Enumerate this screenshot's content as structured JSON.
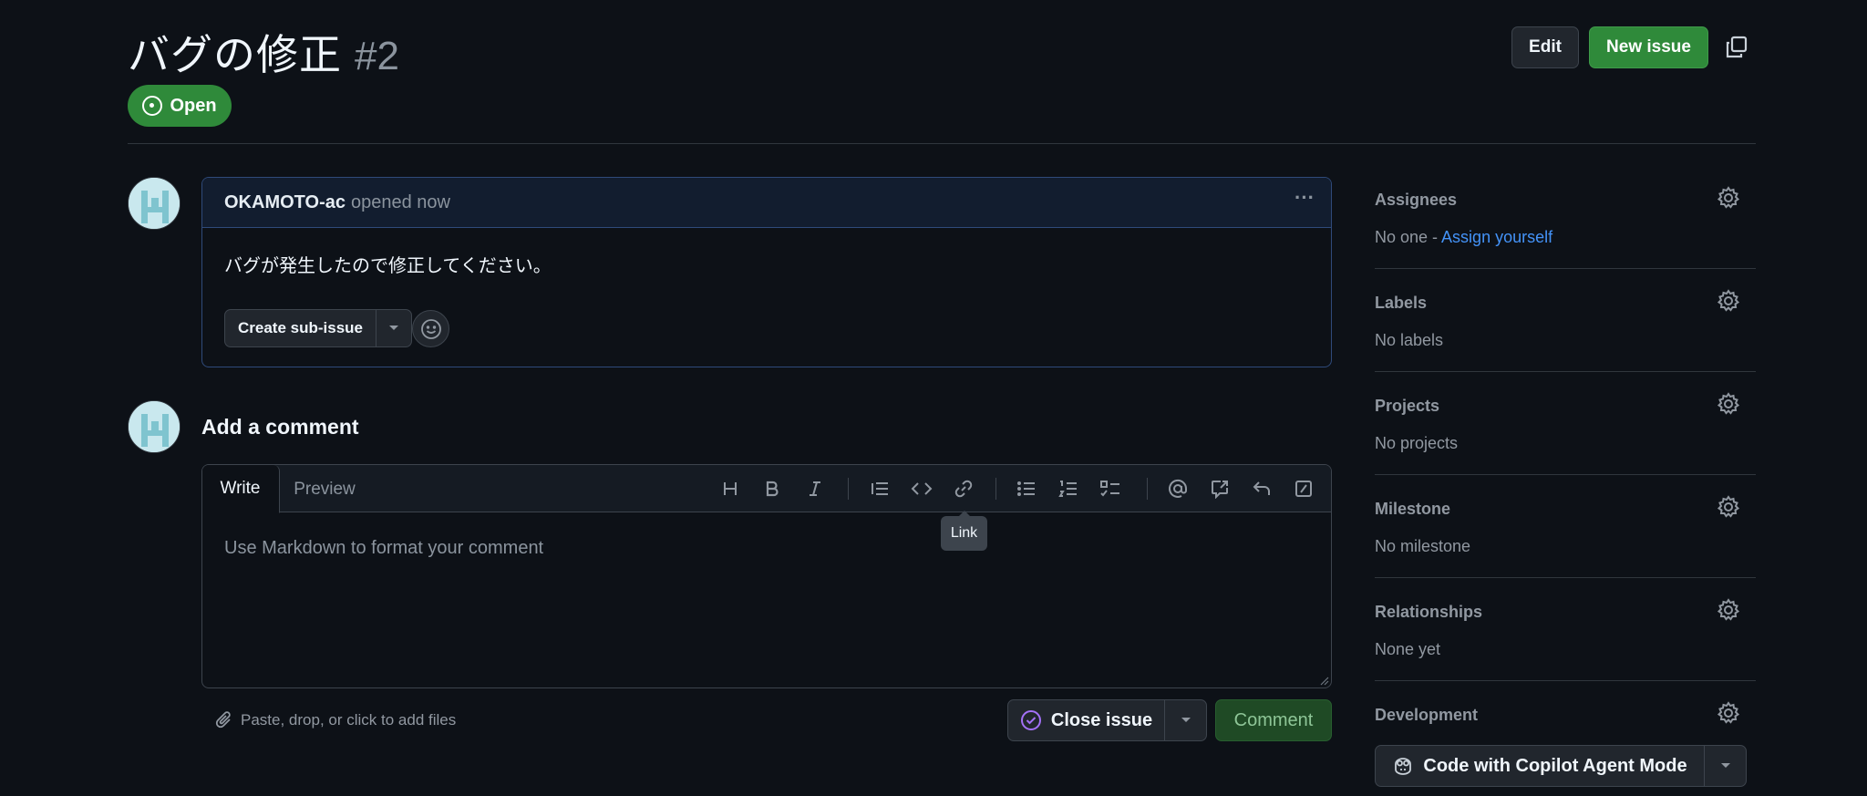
{
  "issue": {
    "title": "バグの修正",
    "number": "#2",
    "state": "Open"
  },
  "header": {
    "edit_label": "Edit",
    "new_issue_label": "New issue"
  },
  "comment": {
    "author": "OKAMOTO-ac",
    "time_text": "opened now",
    "body": "バグが発生したので修正してください。",
    "sub_issue_label": "Create sub-issue"
  },
  "composer": {
    "heading": "Add a comment",
    "tabs": {
      "write": "Write",
      "preview": "Preview"
    },
    "toolbar": [
      "heading-icon",
      "bold-icon",
      "italic-icon",
      "quote-icon",
      "code-icon",
      "link-icon",
      "unordered-list-icon",
      "ordered-list-icon",
      "task-list-icon",
      "mention-icon",
      "cross-reference-icon",
      "reply-icon",
      "slash-command-icon"
    ],
    "placeholder": "Use Markdown to format your comment",
    "tooltip": "Link",
    "attach_text": "Paste, drop, or click to add files",
    "close_issue_label": "Close issue",
    "comment_label": "Comment"
  },
  "sidebar": {
    "assignees": {
      "title": "Assignees",
      "value": "No one - ",
      "link": "Assign yourself"
    },
    "labels": {
      "title": "Labels",
      "value": "No labels"
    },
    "projects": {
      "title": "Projects",
      "value": "No projects"
    },
    "milestone": {
      "title": "Milestone",
      "value": "No milestone"
    },
    "relationships": {
      "title": "Relationships",
      "value": "None yet"
    },
    "development": {
      "title": "Development",
      "copilot_label": "Code with Copilot Agent Mode"
    }
  },
  "colors": {
    "background": "#0d1117",
    "open_green": "#2f8a3a",
    "link_blue": "#4493f8",
    "close_purple": "#a371f7"
  }
}
